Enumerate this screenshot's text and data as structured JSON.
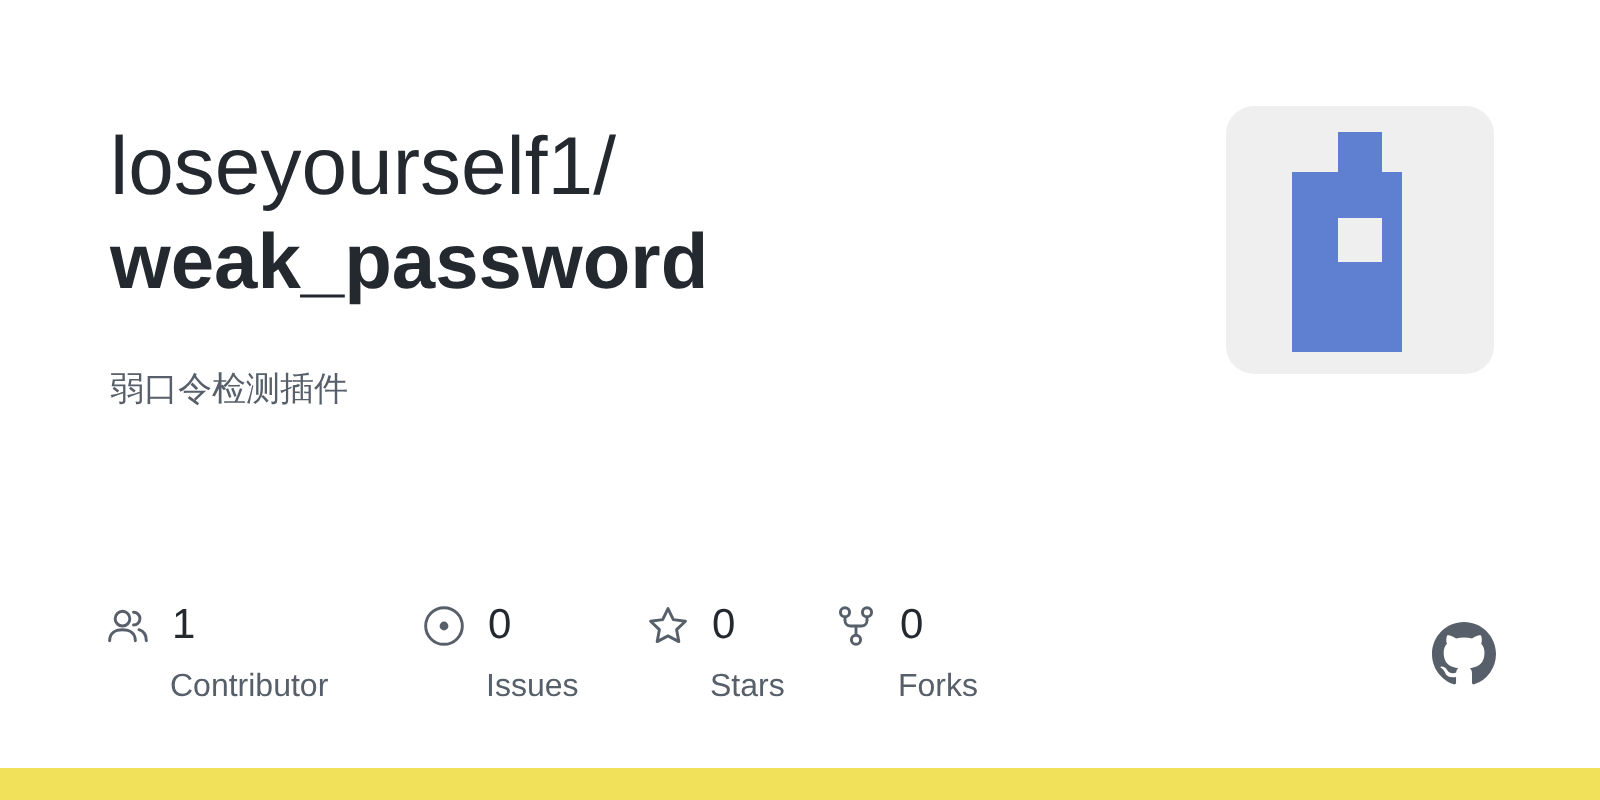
{
  "repo": {
    "owner": "loseyourself1/",
    "name": "weak_password",
    "description": "弱口令检测插件"
  },
  "stats": [
    {
      "kind": "contributors",
      "count": "1",
      "label": "Contributor"
    },
    {
      "kind": "issues",
      "count": "0",
      "label": "Issues"
    },
    {
      "kind": "stars",
      "count": "0",
      "label": "Stars"
    },
    {
      "kind": "forks",
      "count": "0",
      "label": "Forks"
    }
  ]
}
